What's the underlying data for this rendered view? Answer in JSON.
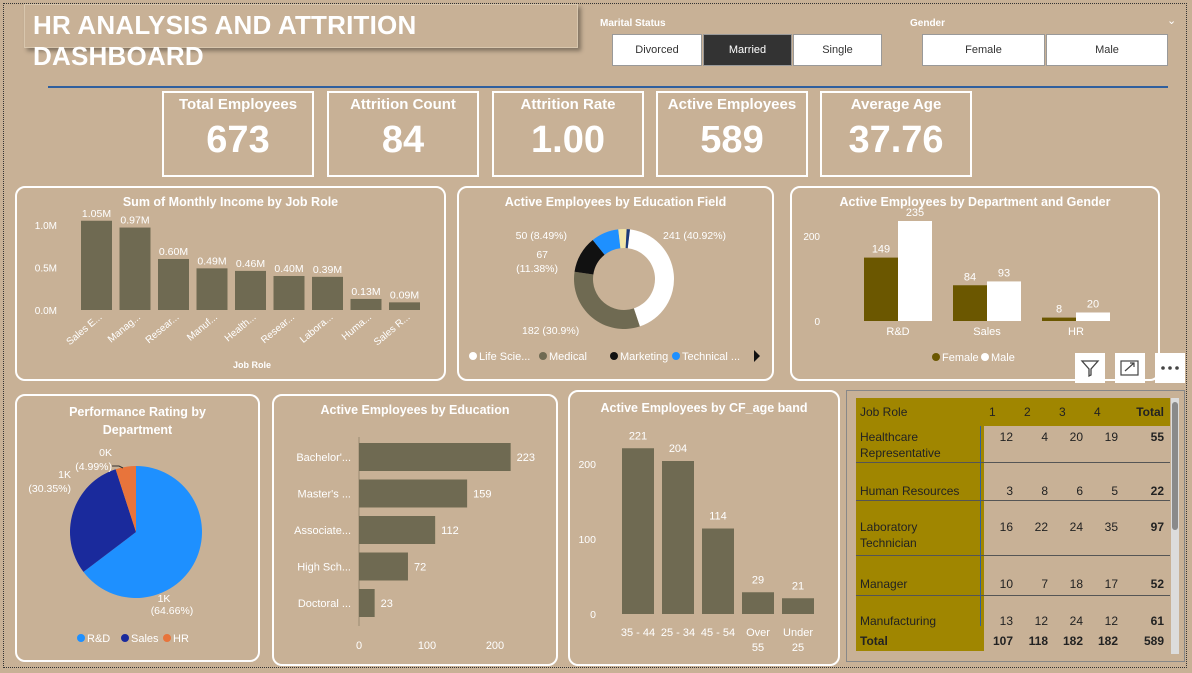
{
  "dashboard": {
    "title": "HR ANALYSIS AND ATTRITION DASHBOARD"
  },
  "slicers": {
    "marital": {
      "label": "Marital Status",
      "options": [
        "Divorced",
        "Married",
        "Single"
      ],
      "selected": "Married"
    },
    "gender": {
      "label": "Gender",
      "options": [
        "Female",
        "Male"
      ]
    }
  },
  "kpis": [
    {
      "label": "Total Employees",
      "value": "673"
    },
    {
      "label": "Attrition Count",
      "value": "84"
    },
    {
      "label": "Attrition Rate",
      "value": "1.00"
    },
    {
      "label": "Active Employees",
      "value": "589"
    },
    {
      "label": "Average Age",
      "value": "37.76"
    }
  ],
  "colors": {
    "bg": "#c8b196",
    "bar": "#6f6a52",
    "olive": "#6b5700",
    "gold": "#a08600",
    "blue": "#1e90ff",
    "navy": "#1a2a9c",
    "orange": "#e8743b"
  },
  "chart_data": [
    {
      "type": "bar",
      "title": "Sum of Monthly Income by Job Role",
      "xlabel": "Job Role",
      "categories": [
        "Sales E...",
        "Manag...",
        "Resear...",
        "Manuf...",
        "Health...",
        "Resear...",
        "Labora...",
        "Huma...",
        "Sales R..."
      ],
      "values": [
        1.05,
        0.97,
        0.6,
        0.49,
        0.46,
        0.4,
        0.39,
        0.13,
        0.09
      ],
      "data_labels": [
        "1.05M",
        "0.97M",
        "0.60M",
        "0.49M",
        "0.46M",
        "0.40M",
        "0.39M",
        "0.13M",
        "0.09M"
      ],
      "yticks": [
        "0.0M",
        "0.5M",
        "1.0M"
      ],
      "ylim": [
        0,
        1.2
      ]
    },
    {
      "type": "pie",
      "title": "Active Employees by Education Field",
      "donut": true,
      "labels": [
        "Life Scie...",
        "Medical",
        "Marketing",
        "Technical ..."
      ],
      "values": [
        241,
        182,
        67,
        50
      ],
      "data_labels": [
        "241 (40.92%)",
        "182 (30.9%)",
        "67",
        "(11.38%)",
        "50 (8.49%)"
      ],
      "legend": [
        "Life Scie...",
        "Medical",
        "Marketing",
        "Technical ..."
      ],
      "colors": [
        "#ffffff",
        "#6f6a52",
        "#111111",
        "#1e90ff",
        "#f0e4a8",
        "#1a3a7a"
      ]
    },
    {
      "type": "bar",
      "title": "Active Employees by Department and Gender",
      "categories": [
        "R&D",
        "Sales",
        "HR"
      ],
      "series": [
        {
          "name": "Female",
          "values": [
            149,
            84,
            8
          ]
        },
        {
          "name": "Male",
          "values": [
            235,
            93,
            20
          ]
        }
      ],
      "yticks": [
        "0",
        "200"
      ],
      "ylim": [
        0,
        260
      ]
    },
    {
      "type": "pie",
      "title": "Performance Rating by Department",
      "labels": [
        "R&D",
        "Sales",
        "HR"
      ],
      "values": [
        64.66,
        30.35,
        4.99
      ],
      "data_labels": [
        "1K",
        "(64.66%)",
        "1K",
        "(30.35%)",
        "0K",
        "(4.99%)"
      ],
      "legend": [
        "R&D",
        "Sales",
        "HR"
      ]
    },
    {
      "type": "bar",
      "orientation": "horizontal",
      "title": "Active Employees by Education",
      "categories": [
        "Bachelor'...",
        "Master's ...",
        "Associate...",
        "High Sch...",
        "Doctoral ..."
      ],
      "values": [
        223,
        159,
        112,
        72,
        23
      ],
      "xticks": [
        "0",
        "100",
        "200"
      ],
      "xlim": [
        0,
        250
      ]
    },
    {
      "type": "bar",
      "title": "Active Employees by CF_age band",
      "categories": [
        "35 - 44",
        "25 - 34",
        "45 - 54",
        "Over 55",
        "Under 25"
      ],
      "cat_lines": [
        [
          "35 - 44"
        ],
        [
          "25 - 34"
        ],
        [
          "45 - 54"
        ],
        [
          "Over",
          "55"
        ],
        [
          "Under",
          "25"
        ]
      ],
      "values": [
        221,
        204,
        114,
        29,
        21
      ],
      "yticks": [
        "0",
        "100",
        "200"
      ],
      "ylim": [
        0,
        240
      ]
    }
  ],
  "matrix": {
    "headers": [
      "Job Role",
      "1",
      "2",
      "3",
      "4",
      "Total"
    ],
    "rows": [
      {
        "role": [
          "Healthcare",
          "Representative"
        ],
        "vals": [
          "12",
          "4",
          "20",
          "19",
          "55"
        ]
      },
      {
        "role": [
          "Human Resources"
        ],
        "vals": [
          "3",
          "8",
          "6",
          "5",
          "22"
        ]
      },
      {
        "role": [
          "Laboratory",
          "Technician"
        ],
        "vals": [
          "16",
          "22",
          "24",
          "35",
          "97"
        ]
      },
      {
        "role": [
          "Manager"
        ],
        "vals": [
          "10",
          "7",
          "18",
          "17",
          "52"
        ]
      },
      {
        "role": [
          "Manufacturing"
        ],
        "vals": [
          "13",
          "12",
          "24",
          "12",
          "61"
        ]
      }
    ],
    "total": {
      "label": "Total",
      "vals": [
        "107",
        "118",
        "182",
        "182",
        "589"
      ]
    }
  }
}
